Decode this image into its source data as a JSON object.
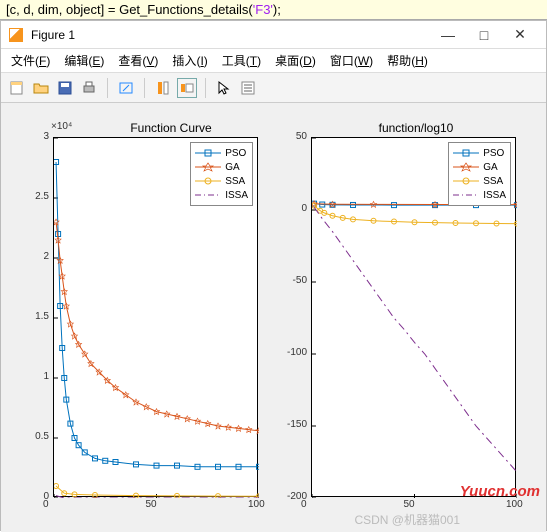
{
  "code": {
    "pre": "[c, d, dim, object] = Get_Functions_details(",
    "arg": "'F3'",
    "post": ");"
  },
  "window_title": "Figure 1",
  "menus": {
    "file": {
      "label": "文件",
      "accel": "F"
    },
    "edit": {
      "label": "编辑",
      "accel": "E"
    },
    "view": {
      "label": "查看",
      "accel": "V"
    },
    "insert": {
      "label": "插入",
      "accel": "I"
    },
    "tools": {
      "label": "工具",
      "accel": "T"
    },
    "desktop": {
      "label": "桌面",
      "accel": "D"
    },
    "window": {
      "label": "窗口",
      "accel": "W"
    },
    "help": {
      "label": "帮助",
      "accel": "H"
    }
  },
  "legend_labels": [
    "PSO",
    "GA",
    "SSA",
    "ISSA"
  ],
  "series_colors": {
    "PSO": "#0072bd",
    "GA": "#d95319",
    "SSA": "#edb120",
    "ISSA": "#7e2f8e"
  },
  "chart_data": [
    {
      "type": "line",
      "title": "Function Curve",
      "ylabel_mult": "×10⁴",
      "xlim": [
        0,
        100
      ],
      "ylim": [
        0,
        3
      ],
      "xticks": [
        0,
        50,
        100
      ],
      "yticks": [
        0,
        0.5,
        1,
        1.5,
        2,
        2.5,
        3
      ],
      "series": [
        {
          "name": "PSO",
          "marker": "square",
          "values": [
            [
              1,
              2.8
            ],
            [
              2,
              2.2
            ],
            [
              3,
              1.6
            ],
            [
              4,
              1.25
            ],
            [
              5,
              1.0
            ],
            [
              6,
              0.82
            ],
            [
              8,
              0.62
            ],
            [
              10,
              0.5
            ],
            [
              12,
              0.44
            ],
            [
              15,
              0.38
            ],
            [
              20,
              0.33
            ],
            [
              25,
              0.31
            ],
            [
              30,
              0.3
            ],
            [
              40,
              0.28
            ],
            [
              50,
              0.27
            ],
            [
              60,
              0.27
            ],
            [
              70,
              0.26
            ],
            [
              80,
              0.26
            ],
            [
              90,
              0.26
            ],
            [
              100,
              0.26
            ]
          ]
        },
        {
          "name": "GA",
          "marker": "star",
          "values": [
            [
              1,
              2.3
            ],
            [
              2,
              2.15
            ],
            [
              3,
              1.98
            ],
            [
              4,
              1.85
            ],
            [
              5,
              1.72
            ],
            [
              6,
              1.6
            ],
            [
              8,
              1.45
            ],
            [
              10,
              1.35
            ],
            [
              12,
              1.28
            ],
            [
              15,
              1.2
            ],
            [
              18,
              1.12
            ],
            [
              22,
              1.05
            ],
            [
              26,
              0.98
            ],
            [
              30,
              0.92
            ],
            [
              35,
              0.86
            ],
            [
              40,
              0.8
            ],
            [
              45,
              0.76
            ],
            [
              50,
              0.72
            ],
            [
              55,
              0.7
            ],
            [
              60,
              0.68
            ],
            [
              65,
              0.66
            ],
            [
              70,
              0.64
            ],
            [
              75,
              0.62
            ],
            [
              80,
              0.6
            ],
            [
              85,
              0.59
            ],
            [
              90,
              0.58
            ],
            [
              95,
              0.57
            ],
            [
              100,
              0.56
            ]
          ]
        },
        {
          "name": "SSA",
          "marker": "circle",
          "values": [
            [
              1,
              0.1
            ],
            [
              5,
              0.04
            ],
            [
              10,
              0.03
            ],
            [
              20,
              0.025
            ],
            [
              40,
              0.02
            ],
            [
              60,
              0.018
            ],
            [
              80,
              0.016
            ],
            [
              100,
              0.015
            ]
          ]
        },
        {
          "name": "ISSA",
          "marker": "dashdot",
          "values": [
            [
              1,
              0.02
            ],
            [
              5,
              0.0
            ],
            [
              10,
              0.0
            ],
            [
              50,
              0.0
            ],
            [
              100,
              0.0
            ]
          ]
        }
      ]
    },
    {
      "type": "line",
      "title": "function/log10",
      "xlim": [
        0,
        100
      ],
      "ylim": [
        -200,
        50
      ],
      "xticks": [
        0,
        50,
        100
      ],
      "yticks": [
        -200,
        -150,
        -100,
        -50,
        0,
        50
      ],
      "series": [
        {
          "name": "PSO",
          "marker": "square",
          "values": [
            [
              1,
              4.4
            ],
            [
              5,
              3.8
            ],
            [
              10,
              3.6
            ],
            [
              20,
              3.5
            ],
            [
              40,
              3.4
            ],
            [
              60,
              3.4
            ],
            [
              80,
              3.4
            ],
            [
              100,
              3.4
            ]
          ]
        },
        {
          "name": "GA",
          "marker": "star",
          "values": [
            [
              1,
              4.3
            ],
            [
              10,
              4.0
            ],
            [
              30,
              3.9
            ],
            [
              60,
              3.8
            ],
            [
              100,
              3.75
            ]
          ]
        },
        {
          "name": "SSA",
          "marker": "circle",
          "values": [
            [
              1,
              3.0
            ],
            [
              4,
              -0.5
            ],
            [
              6,
              -2.0
            ],
            [
              10,
              -4.0
            ],
            [
              15,
              -5.5
            ],
            [
              20,
              -6.5
            ],
            [
              30,
              -7.5
            ],
            [
              40,
              -8.0
            ],
            [
              50,
              -8.5
            ],
            [
              60,
              -8.8
            ],
            [
              70,
              -9.0
            ],
            [
              80,
              -9.2
            ],
            [
              90,
              -9.4
            ],
            [
              100,
              -9.5
            ]
          ]
        },
        {
          "name": "ISSA",
          "marker": "dashdot",
          "values": [
            [
              1,
              2.0
            ],
            [
              5,
              -6
            ],
            [
              10,
              -15
            ],
            [
              15,
              -25
            ],
            [
              20,
              -35
            ],
            [
              25,
              -45
            ],
            [
              30,
              -55
            ],
            [
              35,
              -65
            ],
            [
              40,
              -75
            ],
            [
              45,
              -83
            ],
            [
              50,
              -92
            ],
            [
              55,
              -100
            ],
            [
              60,
              -110
            ],
            [
              65,
              -120
            ],
            [
              70,
              -130
            ],
            [
              75,
              -140
            ],
            [
              80,
              -150
            ],
            [
              85,
              -158
            ],
            [
              90,
              -166
            ],
            [
              95,
              -174
            ],
            [
              100,
              -182
            ]
          ]
        }
      ]
    }
  ],
  "watermarks": {
    "site": "Yuucn.com",
    "csdn": "CSDN @机器猫001"
  }
}
